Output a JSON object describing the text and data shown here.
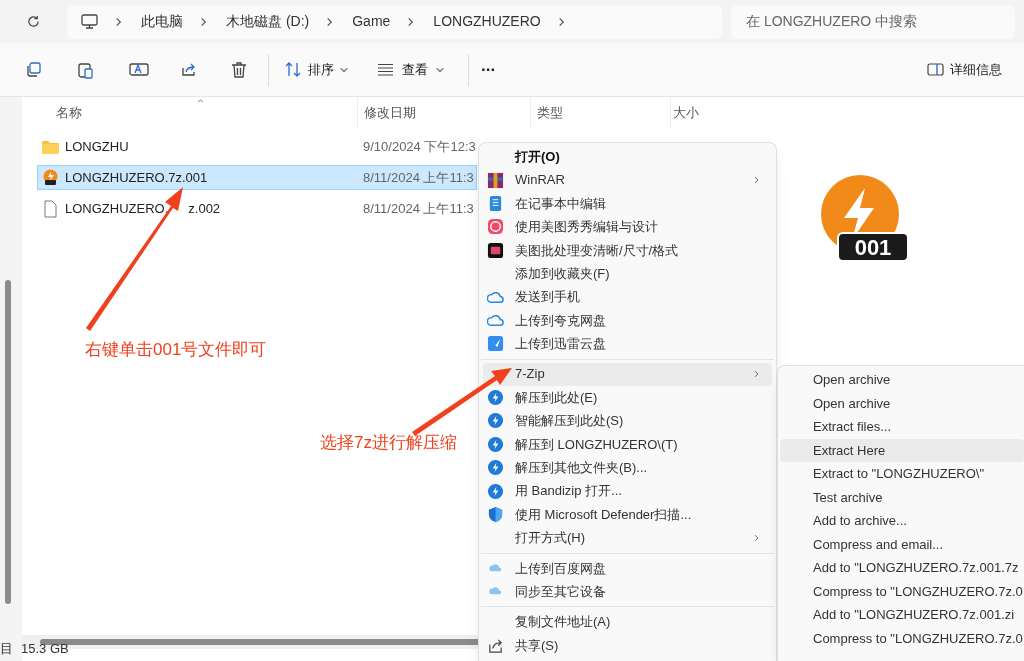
{
  "address_bar": {
    "breadcrumbs": [
      "此电脑",
      "木地磁盘 (D:)",
      "Game",
      "LONGZHUZERO"
    ]
  },
  "search": {
    "placeholder": "在 LONGZHUZERO 中搜索"
  },
  "toolbar": {
    "sort": "排序",
    "view": "查看",
    "more": "...",
    "details": "详细信息"
  },
  "columns": [
    "名称",
    "修改日期",
    "类型",
    "大小"
  ],
  "files": [
    {
      "kind": "folder",
      "name": "LONGZHU",
      "date": "9/10/2024 下午12:3",
      "selected": false
    },
    {
      "kind": "archive",
      "name": "LONGZHUZERO.7z.001",
      "date": "8/11/2024 上午11:3",
      "selected": true
    },
    {
      "kind": "file",
      "name": "LONGZHUZERO.",
      "name_after_arrow": "z.002",
      "date": "8/11/2024 上午11:3",
      "selected": false
    }
  ],
  "preview": {
    "badge": "001"
  },
  "status_bar": {
    "items": "目",
    "size": "15.3 GB"
  },
  "context_menu": {
    "groups": [
      [
        {
          "label": "打开(O)",
          "default": true,
          "submenu": false,
          "selected": false
        },
        {
          "label": "WinRAR",
          "default": false,
          "submenu": true,
          "selected": false
        },
        {
          "label": "在记事本中编辑",
          "default": false,
          "submenu": false,
          "selected": false
        },
        {
          "label": "使用美图秀秀编辑与设计",
          "default": false,
          "submenu": false,
          "selected": false
        },
        {
          "label": "美图批处理变清晰/尺寸/格式",
          "default": false,
          "submenu": false,
          "selected": false
        },
        {
          "label": "添加到收藏夹(F)",
          "default": false,
          "submenu": false,
          "selected": false
        },
        {
          "label": "发送到手机",
          "default": false,
          "submenu": false,
          "selected": false
        },
        {
          "label": "上传到夸克网盘",
          "default": false,
          "submenu": false,
          "selected": false
        },
        {
          "label": "上传到迅雷云盘",
          "default": false,
          "submenu": false,
          "selected": false
        }
      ],
      [
        {
          "label": "7-Zip",
          "default": false,
          "submenu": true,
          "selected": true
        },
        {
          "label": "解压到此处(E)",
          "default": false,
          "submenu": false,
          "selected": false
        },
        {
          "label": "智能解压到此处(S)",
          "default": false,
          "submenu": false,
          "selected": false
        },
        {
          "label": "解压到 LONGZHUZERO\\(T)",
          "default": false,
          "submenu": false,
          "selected": false
        },
        {
          "label": "解压到其他文件夹(B)...",
          "default": false,
          "submenu": false,
          "selected": false
        },
        {
          "label": "用 Bandizip 打开...",
          "default": false,
          "submenu": false,
          "selected": false
        },
        {
          "label": "使用 Microsoft Defender扫描...",
          "default": false,
          "submenu": false,
          "selected": false
        },
        {
          "label": "打开方式(H)",
          "default": false,
          "submenu": true,
          "selected": false
        }
      ],
      [
        {
          "label": "上传到百度网盘",
          "default": false,
          "submenu": false,
          "selected": false
        },
        {
          "label": "同步至其它设备",
          "default": false,
          "submenu": false,
          "selected": false
        }
      ],
      [
        {
          "label": "复制文件地址(A)",
          "default": false,
          "submenu": false,
          "selected": false
        },
        {
          "label": "共享(S)",
          "default": false,
          "submenu": false,
          "selected": false
        }
      ]
    ]
  },
  "submenu": {
    "items": [
      {
        "label": "Open archive",
        "selected": false
      },
      {
        "label": "Open archive",
        "selected": false
      },
      {
        "label": "Extract files...",
        "selected": false
      },
      {
        "label": "Extract Here",
        "selected": true
      },
      {
        "label": "Extract to \"LONGZHUZERO\\\"",
        "selected": false
      },
      {
        "label": "Test archive",
        "selected": false
      },
      {
        "label": "Add to archive...",
        "selected": false
      },
      {
        "label": "Compress and email...",
        "selected": false
      },
      {
        "label": "Add to \"LONGZHUZERO.7z.001.7z",
        "selected": false
      },
      {
        "label": "Compress to \"LONGZHUZERO.7z.0",
        "selected": false
      },
      {
        "label": "Add to \"LONGZHUZERO.7z.001.zi",
        "selected": false
      },
      {
        "label": "Compress to \"LONGZHUZERO.7z.0",
        "selected": false
      }
    ]
  },
  "annotations": [
    {
      "text": "右键单击001号文件即可"
    },
    {
      "text": "选择7z进行解压缩"
    }
  ]
}
